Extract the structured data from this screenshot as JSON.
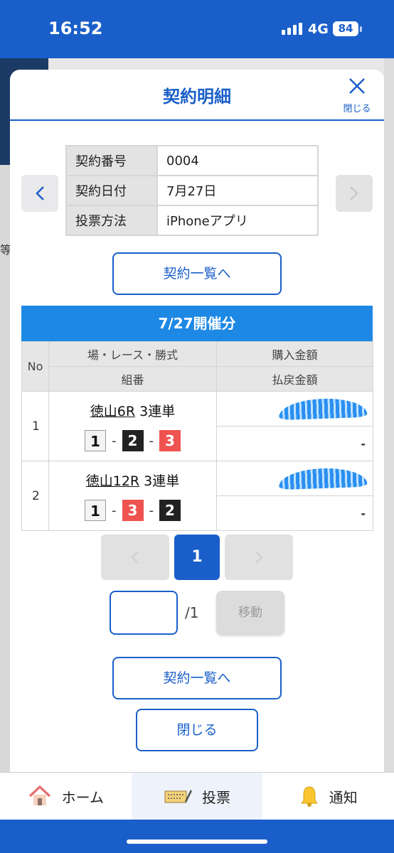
{
  "status": {
    "time": "16:52",
    "network": "4G",
    "battery": "84"
  },
  "background": {
    "partial_char": "等"
  },
  "modal": {
    "title": "契約明細",
    "close_label": "閉じる",
    "info_rows": [
      {
        "label": "契約番号",
        "value": "0004"
      },
      {
        "label": "契約日付",
        "value": "7月27日"
      },
      {
        "label": "投票方法",
        "value": "iPhoneアプリ"
      }
    ],
    "list_button": "契約一覧へ",
    "section_title": "7/27開催分",
    "table_headers": {
      "no": "No",
      "race_type": "場・レース・勝式",
      "combination": "組番",
      "purchase_amount": "購入金額",
      "payout_amount": "払戻金額"
    },
    "rows": [
      {
        "no": "1",
        "venue_race": "徳山6R",
        "bet_type": "3連単",
        "combo": [
          "1",
          "2",
          "3"
        ],
        "combo_colors": [
          "white",
          "black",
          "red"
        ],
        "payout": "-"
      },
      {
        "no": "2",
        "venue_race": "徳山12R",
        "bet_type": "3連単",
        "combo": [
          "1",
          "3",
          "2"
        ],
        "combo_colors": [
          "white",
          "red",
          "black"
        ],
        "payout": "-"
      }
    ],
    "pagination": {
      "current": "1",
      "input_value": "",
      "total": "/1",
      "go_label": "移動"
    },
    "list_button_bottom": "契約一覧へ",
    "close_button": "閉じる"
  },
  "tabbar": [
    {
      "label": "ホーム",
      "icon": "home-icon"
    },
    {
      "label": "投票",
      "icon": "ticket-icon",
      "active": true
    },
    {
      "label": "通知",
      "icon": "bell-icon"
    }
  ],
  "colors": {
    "primary": "#1a5fc9",
    "section": "#1e88e5",
    "red_box": "#ef5350"
  }
}
